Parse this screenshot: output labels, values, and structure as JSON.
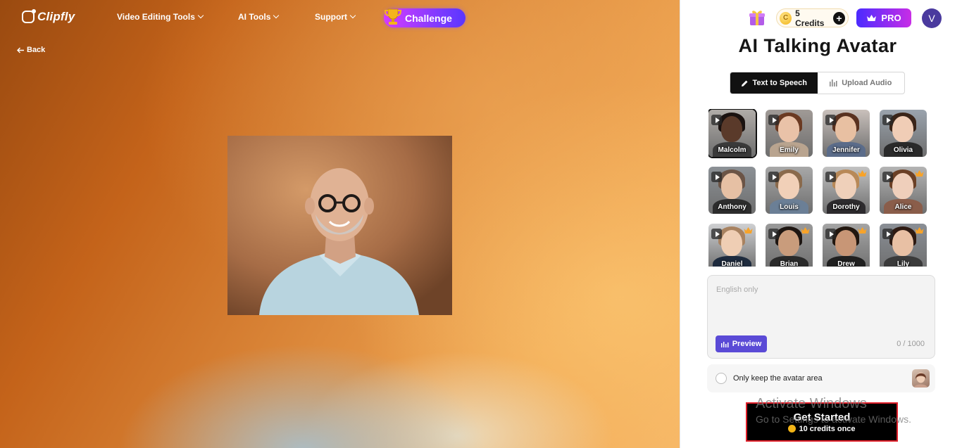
{
  "brand": {
    "name": "Clipfly"
  },
  "nav": {
    "items": [
      {
        "label": "Video Editing Tools"
      },
      {
        "label": "AI Tools"
      },
      {
        "label": "Support"
      }
    ],
    "challenge_label": "Challenge",
    "back_label": "Back"
  },
  "account": {
    "credits_label": "5 Credits",
    "coin_letter": "C",
    "plus": "+",
    "pro_label": "PRO",
    "avatar_initial": "V"
  },
  "panel": {
    "title": "AI Talking Avatar",
    "tabs": [
      {
        "label": "Text to Speech",
        "active": true
      },
      {
        "label": "Upload Audio",
        "active": false
      }
    ]
  },
  "avatars": [
    {
      "name": "Malcolm",
      "selected": true,
      "premium": false
    },
    {
      "name": "Emily",
      "selected": false,
      "premium": false
    },
    {
      "name": "Jennifer",
      "selected": false,
      "premium": false
    },
    {
      "name": "Olivia",
      "selected": false,
      "premium": false
    },
    {
      "name": "Anthony",
      "selected": false,
      "premium": false
    },
    {
      "name": "Louis",
      "selected": false,
      "premium": false
    },
    {
      "name": "Dorothy",
      "selected": false,
      "premium": true
    },
    {
      "name": "Alice",
      "selected": false,
      "premium": true
    },
    {
      "name": "Daniel",
      "selected": false,
      "premium": true
    },
    {
      "name": "Brian",
      "selected": false,
      "premium": true
    },
    {
      "name": "Drew",
      "selected": false,
      "premium": true
    },
    {
      "name": "Lily",
      "selected": false,
      "premium": true
    }
  ],
  "script_input": {
    "placeholder": "English only",
    "preview_label": "Preview",
    "counter": "0 / 1000"
  },
  "options": {
    "keep_avatar_label": "Only keep the avatar area"
  },
  "cta": {
    "label": "Get Started",
    "cost_label": "10 credits once"
  },
  "watermark": {
    "line1": "Activate Windows",
    "line2": "Go to Settings to activate Windows."
  },
  "colors": {
    "accent": "#5a4ad6",
    "pro_gradient_start": "#4b2bff",
    "pro_gradient_end": "#c82de6",
    "cta_border": "#e0202b"
  }
}
